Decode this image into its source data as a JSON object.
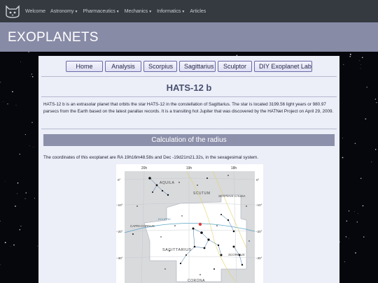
{
  "nav": {
    "items": [
      {
        "label": "Welcome",
        "dropdown": false
      },
      {
        "label": "Astronomy",
        "dropdown": true
      },
      {
        "label": "Pharmaceutics",
        "dropdown": true
      },
      {
        "label": "Mechanics",
        "dropdown": true
      },
      {
        "label": "Informatics",
        "dropdown": true
      },
      {
        "label": "Articles",
        "dropdown": false
      }
    ]
  },
  "header": {
    "title": "EXOPLANETS"
  },
  "menu": {
    "home": "Home",
    "analysis": "Analysis",
    "scorpius": "Scorpius",
    "sagittarius": "Sagittarius",
    "sculptor": "Sculptor",
    "diy": "DIY Exoplanet Lab"
  },
  "article": {
    "title": "HATS-12 b",
    "intro": "HATS-12 b is an extrasolar planet that orbits the star HATS-12 in the constellation of Sagittarius. The star is located 3199.56 light years or 980.97 parsecs from the Earth based on the latest parallax records. It is a transiting hot Jupiter that was discovered by the HATNet Project on April 29, 2009.",
    "section_title": "Calculation of the radius",
    "coords_text": "The coordinates of this exoplanet are RA 19h16m48.58s and Dec -19d21m21.32s, in the sexagesimal system."
  },
  "star_map": {
    "top_ticks": [
      "20h",
      "19h",
      "18h"
    ],
    "left_ticks": [
      "0°",
      "−10°",
      "−20°",
      "−30°"
    ],
    "right_ticks": [
      "0°",
      "−10°",
      "−20°",
      "−30°"
    ],
    "constellations": [
      "AQUILA",
      "SCUTUM",
      "SERPENS CAUDA",
      "CAPRI-CORNUS",
      "SAGITTARIUS",
      "SCORPIUS",
      "CORONA"
    ],
    "ecliptic_label": "ECLIPTIC"
  }
}
